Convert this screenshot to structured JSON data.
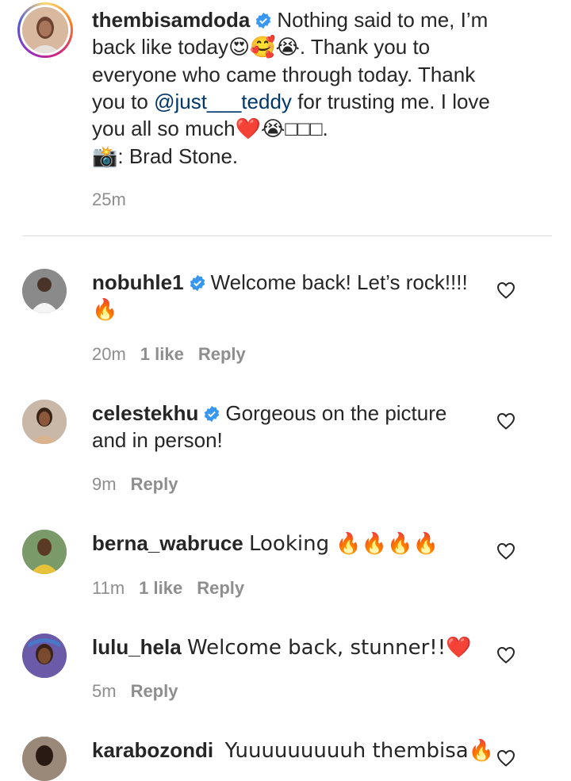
{
  "post_caption": {
    "username": "thembisamdoda",
    "line1": "Nothing said to me, I’m",
    "line2_text": "back like today",
    "line2_emoji": "😍🥰😭",
    "line2_end": ". Thank you to",
    "line3": "everyone who came through today. Thank",
    "line4_start": "you to ",
    "mention": "@just___teddy",
    "line4_end": " for trusting me. I love",
    "line5_text": "you all so much",
    "line5_emoji": "❤️😭",
    "line5_end": "□□□.",
    "credit_icon": "📸",
    "credit_text": ": Brad Stone.",
    "time": "25m"
  },
  "comments": [
    {
      "username": "nobuhle1",
      "verified": true,
      "text": "Welcome back! Let’s rock!!!!",
      "text_cont": "🔥",
      "time": "20m",
      "likes": "1 like",
      "reply": "Reply"
    },
    {
      "username": "celestekhu",
      "verified": true,
      "text": "Gorgeous on the picture",
      "text_cont": "and in person!",
      "time": "9m",
      "likes": "",
      "reply": "Reply"
    },
    {
      "username": "berna_wabruce",
      "verified": false,
      "text": "Looking 🔥🔥🔥🔥",
      "time": "11m",
      "likes": "1 like",
      "reply": "Reply"
    },
    {
      "username": "lulu_hela",
      "verified": false,
      "text": "Welcome back, stunner!!❤️",
      "time": "5m",
      "likes": "",
      "reply": "Reply"
    },
    {
      "username": "karabozondi",
      "verified": false,
      "text": "Yuuuuuuuuuh thembisa🔥",
      "time": "",
      "likes": "",
      "reply": ""
    }
  ],
  "icons": {
    "verified": "verified-badge-icon",
    "like": "heart-outline-icon"
  },
  "colors": {
    "verified_blue": "#3897f0",
    "meta_gray": "#8e8e8e",
    "mention_blue": "#00376b"
  }
}
